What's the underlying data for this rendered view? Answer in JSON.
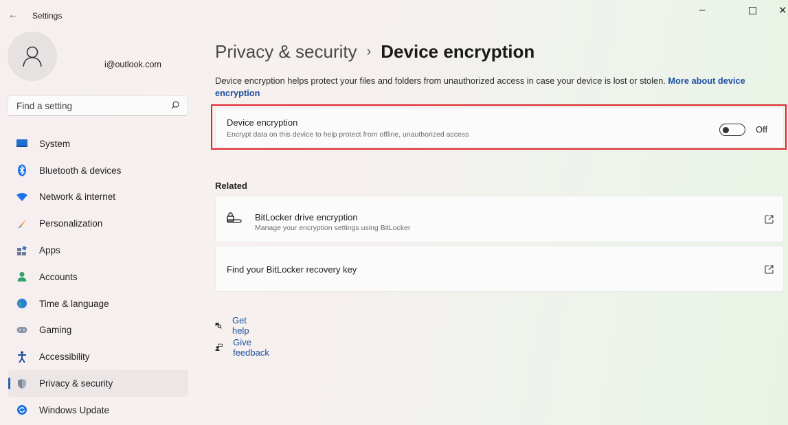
{
  "window": {
    "title": "Settings",
    "back_glyph": "←",
    "minimize_glyph": "–",
    "maximize_glyph": "☐",
    "close_glyph": "✕"
  },
  "account": {
    "email": "i@outlook.com"
  },
  "search": {
    "placeholder": "Find a setting",
    "value": ""
  },
  "sidebar": {
    "items": [
      {
        "label": "System",
        "icon": "system-icon",
        "active": false
      },
      {
        "label": "Bluetooth & devices",
        "icon": "bluetooth-icon",
        "active": false
      },
      {
        "label": "Network & internet",
        "icon": "wifi-icon",
        "active": false
      },
      {
        "label": "Personalization",
        "icon": "brush-icon",
        "active": false
      },
      {
        "label": "Apps",
        "icon": "apps-icon",
        "active": false
      },
      {
        "label": "Accounts",
        "icon": "accounts-icon",
        "active": false
      },
      {
        "label": "Time & language",
        "icon": "globe-icon",
        "active": false
      },
      {
        "label": "Gaming",
        "icon": "gamepad-icon",
        "active": false
      },
      {
        "label": "Accessibility",
        "icon": "accessibility-icon",
        "active": false
      },
      {
        "label": "Privacy & security",
        "icon": "shield-icon",
        "active": true
      },
      {
        "label": "Windows Update",
        "icon": "update-icon",
        "active": false
      }
    ]
  },
  "breadcrumb": {
    "parent": "Privacy & security",
    "separator": "›",
    "current": "Device encryption"
  },
  "description": {
    "text": "Device encryption helps protect your files and folders from unauthorized access in case your device is lost or stolen.",
    "link": "More about device encryption"
  },
  "encryption_setting": {
    "title": "Device encryption",
    "subtitle": "Encrypt data on this device to help protect from offline, unauthorized access",
    "state_label": "Off",
    "enabled": false
  },
  "related": {
    "heading": "Related",
    "bitlocker": {
      "title": "BitLocker drive encryption",
      "subtitle": "Manage your encryption settings using BitLocker"
    },
    "recovery_key": {
      "title": "Find your BitLocker recovery key"
    }
  },
  "help": {
    "get_help": "Get help",
    "give_feedback": "Give feedback"
  },
  "colors": {
    "accent": "#2d5bb5",
    "link": "#1b4fa0",
    "highlight_box": "#e0262f"
  }
}
